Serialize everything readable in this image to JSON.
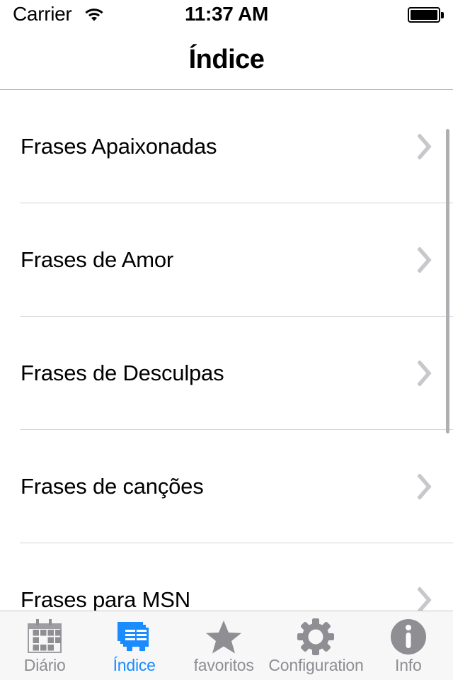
{
  "status_bar": {
    "carrier": "Carrier",
    "wifi_icon": "wifi-icon",
    "time": "11:37 AM",
    "battery_icon": "battery-full-icon"
  },
  "nav_bar": {
    "title": "Índice"
  },
  "colors": {
    "accent": "#1a8cff",
    "inactive_tab": "#8e8e93",
    "separator": "#d3d3d6",
    "chevron": "#c7c7cc",
    "tab_bar_bg": "#f7f7f7",
    "background": "#ffffff",
    "text": "#000000"
  },
  "list": {
    "disclosure_icon": "chevron-right-icon",
    "rows": [
      {
        "label": "Frases Apaixonadas"
      },
      {
        "label": "Frases de Amor"
      },
      {
        "label": "Frases de Desculpas"
      },
      {
        "label": "Frases de canções"
      },
      {
        "label": "Frases para MSN"
      }
    ]
  },
  "scroll": {
    "indicator_visible": true
  },
  "tab_bar": {
    "active_index": 1,
    "tabs": [
      {
        "label": "Diário",
        "icon": "calendar-icon"
      },
      {
        "label": "Índice",
        "icon": "stacked-pages-icon"
      },
      {
        "label": "favoritos",
        "icon": "star-icon"
      },
      {
        "label": "Configuration",
        "icon": "gear-icon"
      },
      {
        "label": "Info",
        "icon": "info-circle-icon"
      }
    ]
  }
}
